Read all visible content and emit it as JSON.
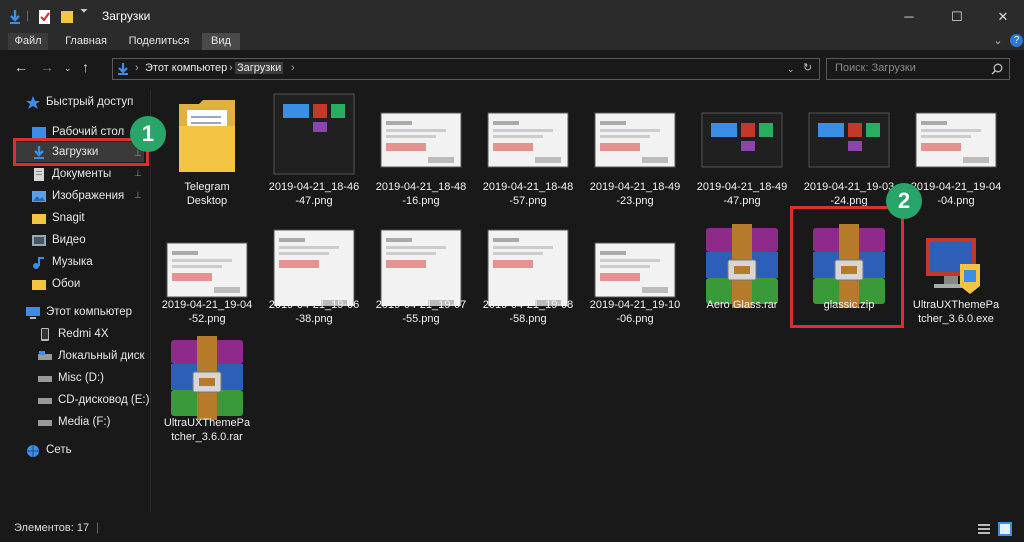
{
  "window": {
    "title": "Загрузки"
  },
  "ribbon": {
    "tabs": [
      "Файл",
      "Главная",
      "Поделиться",
      "Вид"
    ]
  },
  "address": {
    "crumbs": [
      "Этот компьютер",
      "Загрузки"
    ]
  },
  "search": {
    "placeholder": "Поиск: Загрузки"
  },
  "sidebar": {
    "items": [
      {
        "label": "Быстрый доступ",
        "icon": "star-icon"
      },
      {
        "label": "Рабочий стол",
        "icon": "desktop-folder-icon",
        "pinned": true
      },
      {
        "label": "Загрузки",
        "icon": "download-arrow-icon",
        "pinned": true
      },
      {
        "label": "Документы",
        "icon": "documents-folder-icon",
        "pinned": true
      },
      {
        "label": "Изображения",
        "icon": "pictures-folder-icon",
        "pinned": true
      },
      {
        "label": "Snagit",
        "icon": "folder-icon"
      },
      {
        "label": "Видео",
        "icon": "video-folder-icon"
      },
      {
        "label": "Музыка",
        "icon": "music-folder-icon"
      },
      {
        "label": "Обои",
        "icon": "folder-icon"
      },
      {
        "label": "Этот компьютер",
        "icon": "computer-icon"
      },
      {
        "label": "Redmi 4X",
        "icon": "phone-icon"
      },
      {
        "label": "Локальный диск (C",
        "icon": "drive-icon"
      },
      {
        "label": "Misc (D:)",
        "icon": "drive-icon"
      },
      {
        "label": "CD-дисковод (E:)",
        "icon": "drive-icon"
      },
      {
        "label": "Media (F:)",
        "icon": "drive-icon"
      },
      {
        "label": "Сеть",
        "icon": "network-icon"
      }
    ]
  },
  "files": [
    {
      "name": "Telegram\nDesktop",
      "type": "folder"
    },
    {
      "name": "2019-04-21_18-46\n-47.png",
      "type": "png"
    },
    {
      "name": "2019-04-21_18-48\n-16.png",
      "type": "png"
    },
    {
      "name": "2019-04-21_18-48\n-57.png",
      "type": "png"
    },
    {
      "name": "2019-04-21_18-49\n-23.png",
      "type": "png"
    },
    {
      "name": "2019-04-21_18-49\n-47.png",
      "type": "png"
    },
    {
      "name": "2019-04-21_19-03\n-24.png",
      "type": "png"
    },
    {
      "name": "2019-04-21_19-04\n-04.png",
      "type": "png"
    },
    {
      "name": "2019-04-21_19-04\n-52.png",
      "type": "png"
    },
    {
      "name": "2019-04-21_19-06\n-38.png",
      "type": "png"
    },
    {
      "name": "2019-04-21_19-07\n-55.png",
      "type": "png"
    },
    {
      "name": "2019-04-21_19-08\n-58.png",
      "type": "png"
    },
    {
      "name": "2019-04-21_19-10\n-06.png",
      "type": "png"
    },
    {
      "name": "Aero Glass.rar",
      "type": "rar"
    },
    {
      "name": "glassic.zip",
      "type": "rar"
    },
    {
      "name": "UltraUXThemePa\ntcher_3.6.0.exe",
      "type": "exe"
    },
    {
      "name": "UltraUXThemePa\ntcher_3.6.0.rar",
      "type": "rar"
    }
  ],
  "annotations": {
    "badge1": "1",
    "badge2": "2",
    "highlight_color": "#d9322e",
    "badge_color": "#2aa56a"
  },
  "status": {
    "count": "Элементов: 17"
  }
}
